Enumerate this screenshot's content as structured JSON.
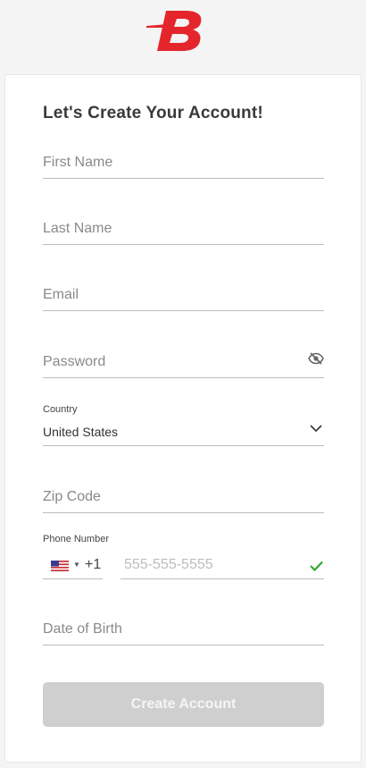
{
  "brand": {
    "logo_letter": "B",
    "color": "#e4262c"
  },
  "form": {
    "title": "Let's Create Your Account!",
    "first_name_placeholder": "First Name",
    "last_name_placeholder": "Last Name",
    "email_placeholder": "Email",
    "password_placeholder": "Password",
    "country_label": "Country",
    "country_value": "United States",
    "zip_placeholder": "Zip Code",
    "phone_label": "Phone Number",
    "phone_dial_code": "+1",
    "phone_placeholder": "555-555-5555",
    "dob_placeholder": "Date of Birth",
    "submit_label": "Create Account"
  },
  "icons": {
    "logo": "brand-logo-icon",
    "password_toggle": "eye-slash-icon",
    "country_dropdown": "chevron-down-icon",
    "flag": "us-flag-icon",
    "phone_valid": "checkmark-icon"
  },
  "colors": {
    "valid": "#2eaa2e",
    "button_disabled": "#cfcfcf",
    "accent": "#e4262c"
  }
}
